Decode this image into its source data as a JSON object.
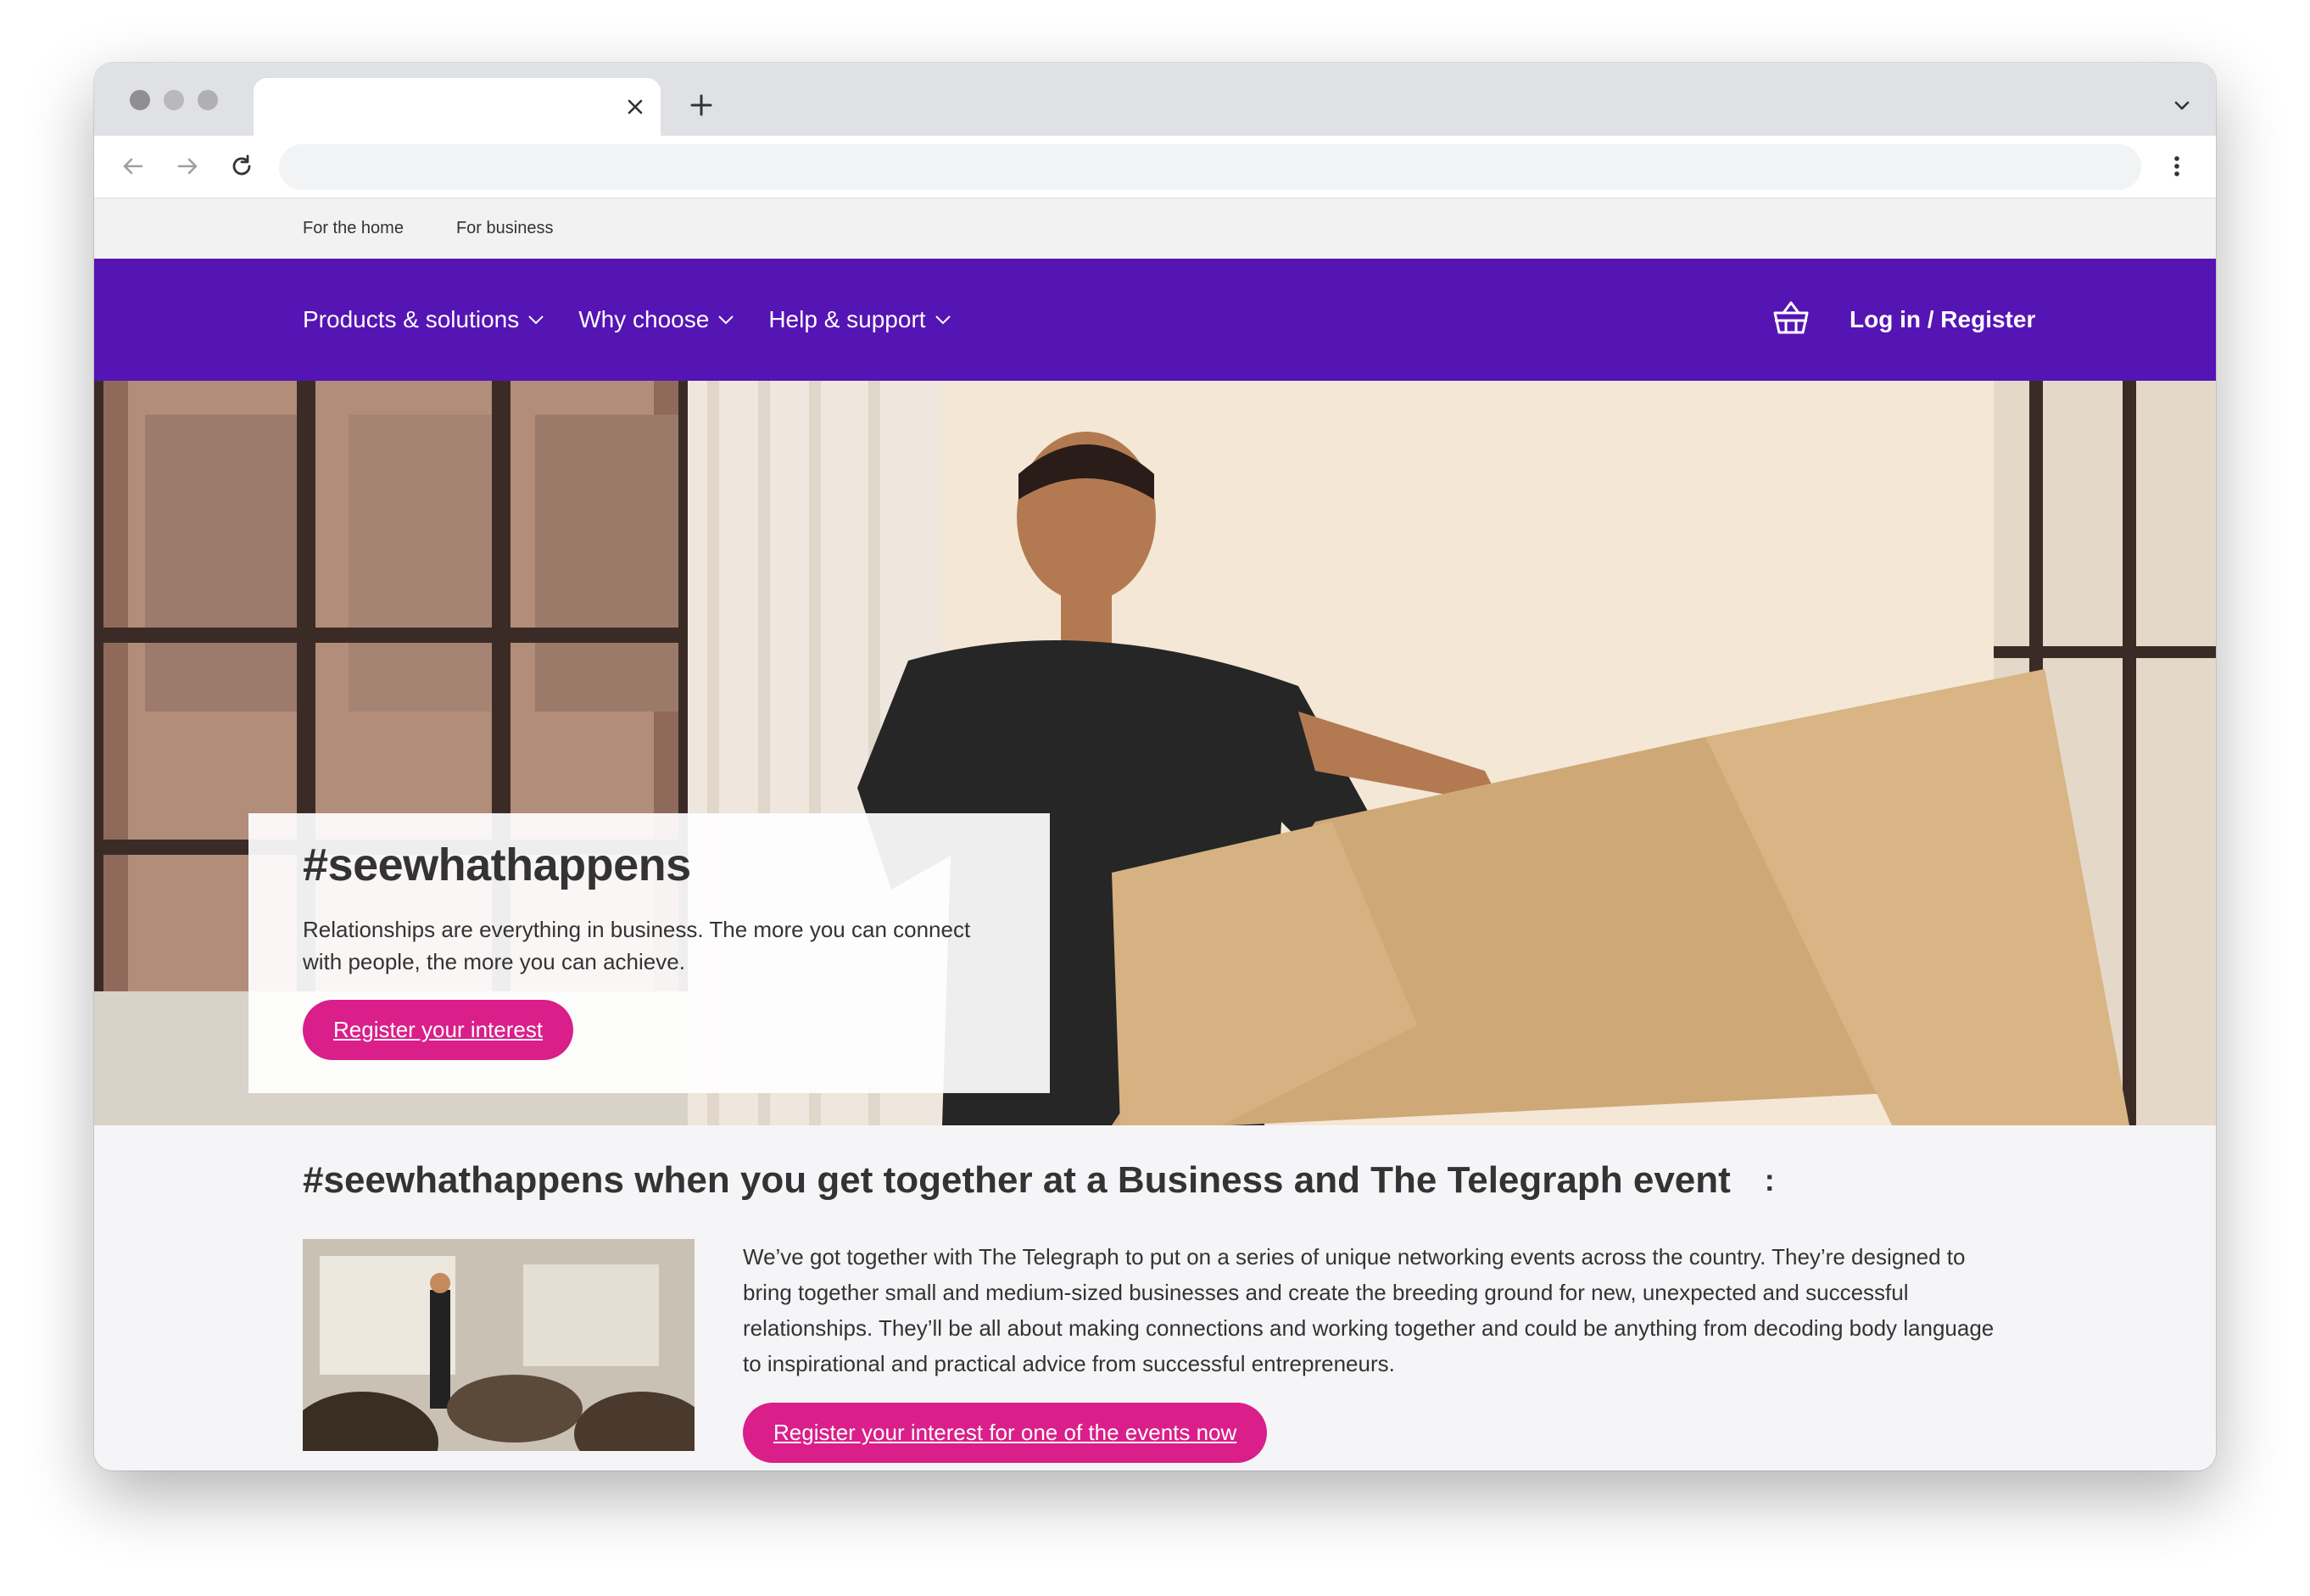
{
  "browser": {
    "tab_title": "",
    "address": ""
  },
  "utility_nav": {
    "items": [
      "For the home",
      "For business"
    ]
  },
  "main_nav": {
    "items": [
      "Products & solutions",
      "Why choose",
      "Help & support"
    ],
    "login_label": "Log in / Register"
  },
  "hero": {
    "title": "#seewhathappens",
    "text": "Relationships are everything in business. The more you can connect with people, the more you can achieve.",
    "cta": "Register your interest"
  },
  "event_section": {
    "title": "#seewhathappens when you get together at a Business and The Telegraph event",
    "more": ":",
    "text": "We’ve got together with The Telegraph to put on a series of unique networking events across the country. They’re designed to bring together small and medium-sized businesses and create the breeding ground for new, unexpected and successful relationships. They’ll be all about making connections and working together and could be anything from decoding body language to inspirational and practical advice from successful entrepreneurs.",
    "cta": "Register your interest for one of the events now"
  },
  "colors": {
    "nav_purple": "#5514b4",
    "cta_pink": "#da1e8a"
  },
  "icons": [
    "close-icon",
    "plus-icon",
    "chevron-down-icon",
    "back-arrow-icon",
    "forward-arrow-icon",
    "reload-icon",
    "kebab-menu-icon",
    "basket-icon"
  ]
}
